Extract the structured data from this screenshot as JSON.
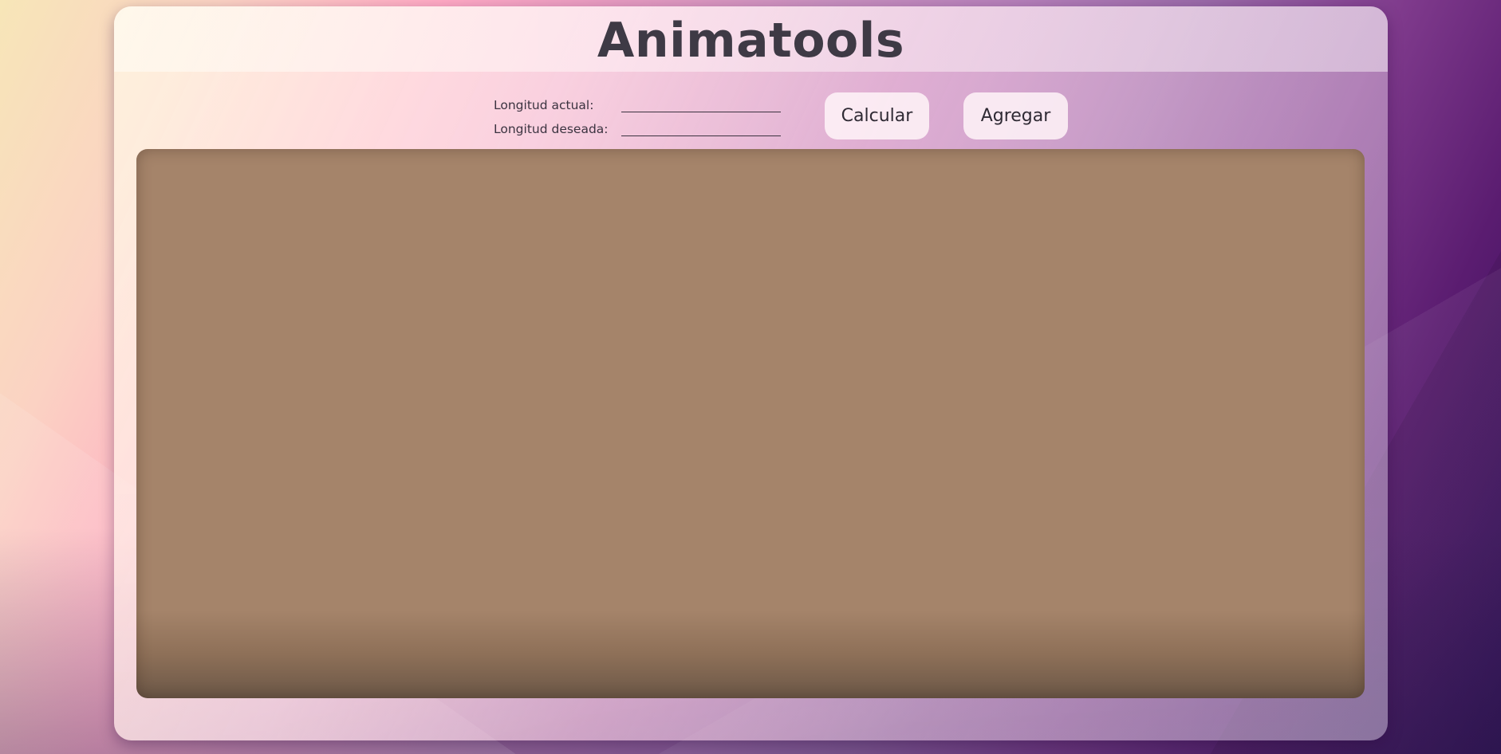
{
  "app": {
    "title": "Animatools"
  },
  "form": {
    "current_length_label": "Longitud actual:",
    "current_length_value": "",
    "desired_length_label": "Longitud deseada:",
    "desired_length_value": ""
  },
  "actions": {
    "calculate_label": "Calcular",
    "add_label": "Agregar"
  },
  "colors": {
    "canvas": "#a5846a",
    "title_text": "#3e3a45",
    "button_bg": "#fff4f8"
  }
}
